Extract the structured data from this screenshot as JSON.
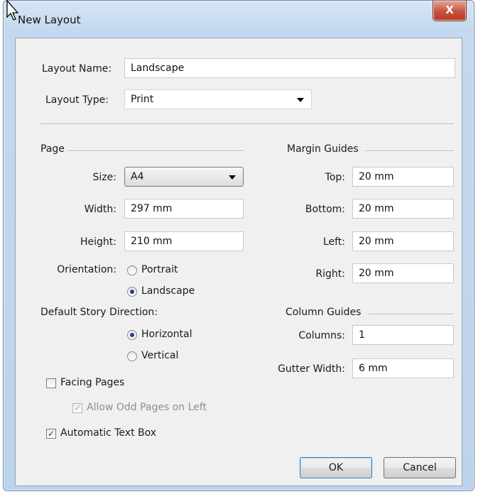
{
  "window": {
    "title": "New Layout",
    "close_label": "X"
  },
  "layout_name": {
    "label": "Layout Name:",
    "value": "Landscape"
  },
  "layout_type": {
    "label": "Layout Type:",
    "value": "Print"
  },
  "page": {
    "heading": "Page",
    "size": {
      "label": "Size:",
      "value": "A4"
    },
    "width": {
      "label": "Width:",
      "value": "297 mm"
    },
    "height": {
      "label": "Height:",
      "value": "210 mm"
    },
    "orientation": {
      "label": "Orientation:",
      "options": [
        "Portrait",
        "Landscape"
      ],
      "selected": "Landscape"
    },
    "story_direction": {
      "label": "Default Story Direction:",
      "options": [
        "Horizontal",
        "Vertical"
      ],
      "selected": "Horizontal"
    }
  },
  "margin_guides": {
    "heading": "Margin Guides",
    "top": {
      "label": "Top:",
      "value": "20 mm"
    },
    "bottom": {
      "label": "Bottom:",
      "value": "20 mm"
    },
    "left": {
      "label": "Left:",
      "value": "20 mm"
    },
    "right": {
      "label": "Right:",
      "value": "20 mm"
    }
  },
  "column_guides": {
    "heading": "Column Guides",
    "columns": {
      "label": "Columns:",
      "value": "1"
    },
    "gutter": {
      "label": "Gutter Width:",
      "value": "6 mm"
    }
  },
  "options": {
    "facing_pages": {
      "label": "Facing Pages",
      "checked": false
    },
    "allow_odd_left": {
      "label": "Allow Odd Pages on Left",
      "checked": true,
      "enabled": false
    },
    "auto_text_box": {
      "label": "Automatic Text Box",
      "checked": true
    }
  },
  "buttons": {
    "ok": "OK",
    "cancel": "Cancel"
  },
  "colors": {
    "accent": "#3c7fb1",
    "close": "#c9503c",
    "dialog_bg": "#f0f0f0"
  },
  "icons": {
    "close": "close-icon",
    "cursor": "cursor-icon",
    "dropdown": "chevron-down-icon"
  }
}
